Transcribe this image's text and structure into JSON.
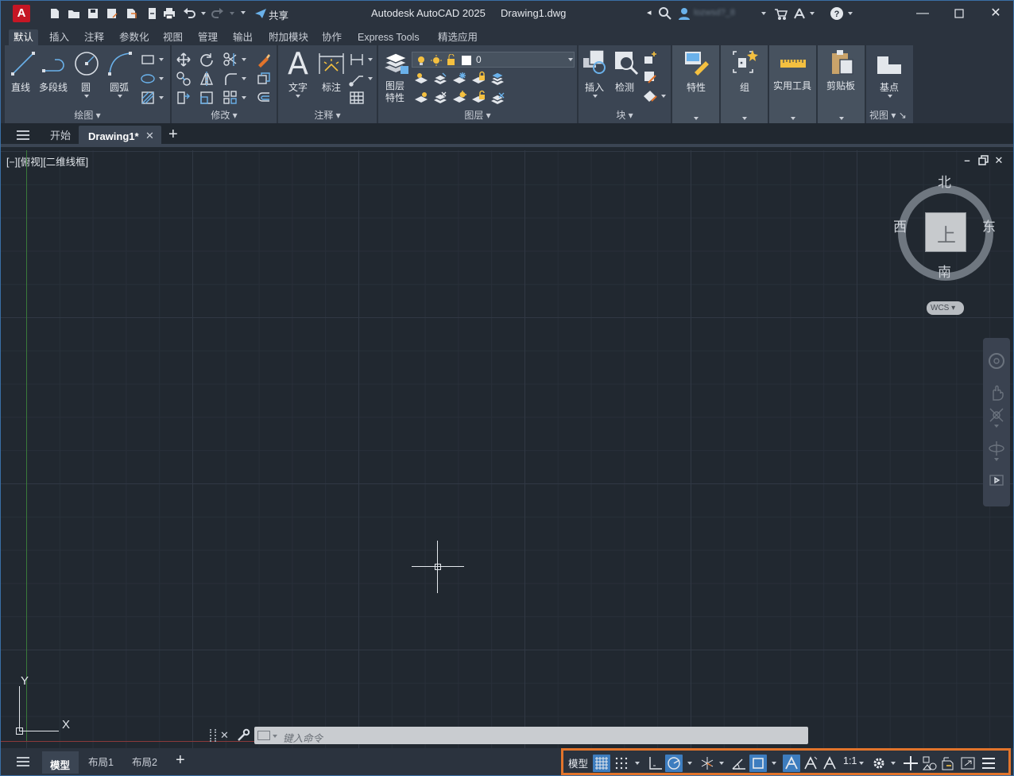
{
  "titlebar": {
    "logo": "A",
    "share_label": "共享",
    "app_title": "Autodesk AutoCAD 2025",
    "doc_title": "Drawing1.dwg",
    "username": "lozwsd?_8"
  },
  "ribbon_tabs": [
    "默认",
    "插入",
    "注释",
    "参数化",
    "视图",
    "管理",
    "输出",
    "附加模块",
    "协作",
    "Express Tools",
    "精选应用"
  ],
  "ribbon": {
    "draw": {
      "title": "绘图",
      "line": "直线",
      "polyline": "多段线",
      "circle": "圆",
      "arc": "圆弧"
    },
    "modify": {
      "title": "修改"
    },
    "annotation": {
      "title": "注释",
      "text": "文字",
      "dimension": "标注"
    },
    "layers": {
      "title": "图层",
      "properties_line1": "图层",
      "properties_line2": "特性",
      "current_layer": "0"
    },
    "block": {
      "title": "块",
      "insert": "插入",
      "inspect": "检测"
    },
    "properties": {
      "label": "特性"
    },
    "groups": {
      "label": "组"
    },
    "utilities": {
      "label": "实用工具"
    },
    "clipboard": {
      "label": "剪贴板"
    },
    "view": {
      "title": "视图",
      "basepoint": "基点"
    }
  },
  "doc_tabs": {
    "start": "开始",
    "drawing": "Drawing1*"
  },
  "viewport": {
    "label": "[−][俯视][二维线框]"
  },
  "viewcube": {
    "north": "北",
    "south": "南",
    "east": "东",
    "west": "西",
    "top": "上",
    "wcs": "WCS"
  },
  "ucs": {
    "x": "X",
    "y": "Y"
  },
  "command_line": {
    "placeholder": "键入命令"
  },
  "layout_tabs": [
    "模型",
    "布局1",
    "布局2"
  ],
  "status": {
    "model": "模型",
    "scale": "1:1"
  },
  "colors": {
    "accent": "#3d7dbf",
    "highlight": "#e2742b",
    "logo": "#c51624"
  }
}
